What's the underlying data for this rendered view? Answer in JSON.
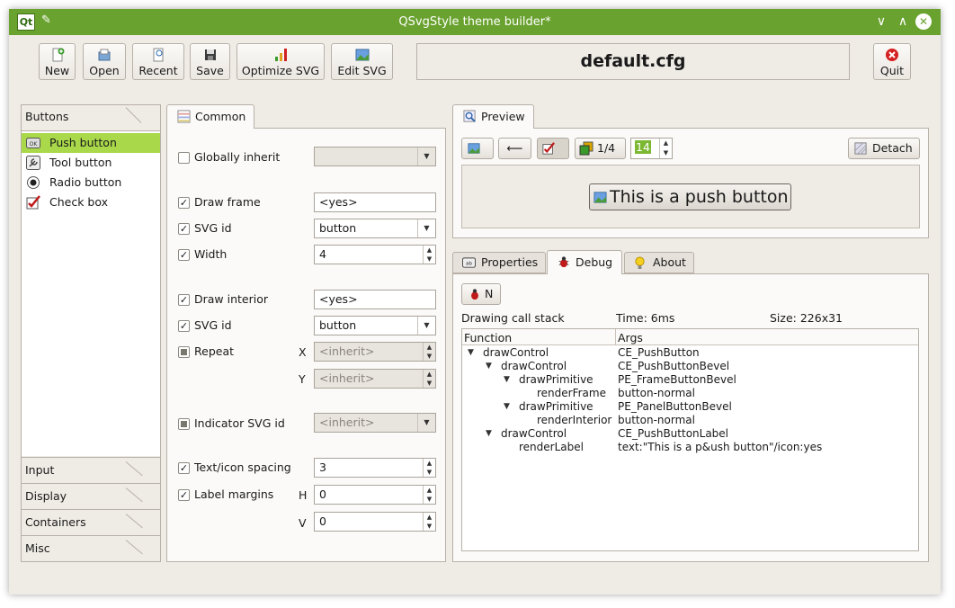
{
  "window": {
    "title": "QSvgStyle theme builder*",
    "minimize": "∨",
    "maximize": "∧",
    "close": "✕"
  },
  "toolbar": {
    "new": "New",
    "open": "Open",
    "recent": "Recent",
    "save": "Save",
    "optimize": "Optimize SVG",
    "edit": "Edit SVG",
    "quit": "Quit",
    "filename": "default.cfg"
  },
  "toolbox": {
    "buttons_header": "Buttons",
    "items": [
      "Push button",
      "Tool button",
      "Radio button",
      "Check box"
    ],
    "sections": [
      "Input",
      "Display",
      "Containers",
      "Misc"
    ]
  },
  "common": {
    "tab": "Common",
    "globally_inherit": "Globally inherit",
    "draw_frame": "Draw frame",
    "draw_frame_value": "<yes>",
    "svg_id": "SVG id",
    "svg_id_value": "button",
    "width": "Width",
    "width_value": "4",
    "draw_interior": "Draw interior",
    "draw_interior_value": "<yes>",
    "svg_id2": "SVG id",
    "svg_id2_value": "button",
    "repeat": "Repeat",
    "x": "X",
    "y": "Y",
    "inherit": "<inherit>",
    "indicator_svg_id": "Indicator SVG id",
    "text_icon_spacing": "Text/icon spacing",
    "spacing_value": "3",
    "label_margins": "Label margins",
    "h": "H",
    "v": "V",
    "h_value": "0",
    "v_value": "0"
  },
  "preview": {
    "tab": "Preview",
    "back": "⟵",
    "page": "1/4",
    "size": "14",
    "detach": "Detach",
    "button_text": "This is a push button"
  },
  "debug": {
    "tabs": [
      "Properties",
      "Debug",
      "About"
    ],
    "n_button": "N",
    "stack_label": "Drawing call stack",
    "time": "Time: 6ms",
    "size": "Size: 226x31",
    "columns": [
      "Function",
      "Args"
    ],
    "rows": [
      {
        "fn": "drawControl",
        "args": "CE_PushButton"
      },
      {
        "fn": "drawControl",
        "args": "CE_PushButtonBevel"
      },
      {
        "fn": "drawPrimitive",
        "args": "PE_FrameButtonBevel"
      },
      {
        "fn": "renderFrame",
        "args": "button-normal"
      },
      {
        "fn": "drawPrimitive",
        "args": "PE_PanelButtonBevel"
      },
      {
        "fn": "renderInterior",
        "args": "button-normal"
      },
      {
        "fn": "drawControl",
        "args": "CE_PushButtonLabel"
      },
      {
        "fn": "renderLabel",
        "args": "text:\"This is a p&ush button\"/icon:yes"
      }
    ]
  }
}
